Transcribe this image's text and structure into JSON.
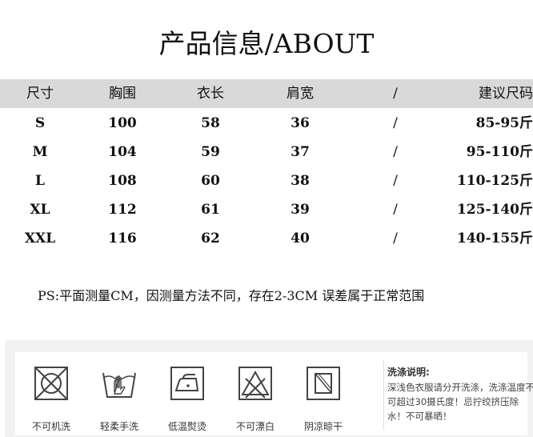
{
  "title": "产品信息/ABOUT",
  "table": {
    "headers": [
      "尺寸",
      "胸围",
      "衣长",
      "肩宽",
      "/",
      "建议尺码"
    ],
    "rows": [
      [
        "S",
        "100",
        "58",
        "36",
        "/",
        "85-95斤"
      ],
      [
        "M",
        "104",
        "59",
        "37",
        "/",
        "95-110斤"
      ],
      [
        "L",
        "108",
        "60",
        "38",
        "/",
        "110-125斤"
      ],
      [
        "XL",
        "112",
        "61",
        "39",
        "/",
        "125-140斤"
      ],
      [
        "XXL",
        "116",
        "62",
        "40",
        "/",
        "140-155斤"
      ]
    ]
  },
  "note": "PS:平面测量CM，因测量方法不同，存在2-3CM 误差属于正常范围",
  "care": {
    "icons": [
      {
        "icon": "no-machine-wash-icon",
        "label": "不可机洗"
      },
      {
        "icon": "gentle-hand-wash-icon",
        "label": "轻柔手洗"
      },
      {
        "icon": "low-temp-iron-icon",
        "label": "低温熨烫"
      },
      {
        "icon": "no-bleach-icon",
        "label": "不可漂白"
      },
      {
        "icon": "shade-dry-icon",
        "label": "阴凉晾干"
      }
    ],
    "instructions_title": "洗涤说明:",
    "instructions_text": "深浅色衣服请分开洗涤，洗涤温度不可超过30摄氏度！忌拧绞挤压除水！不可暴晒！"
  }
}
